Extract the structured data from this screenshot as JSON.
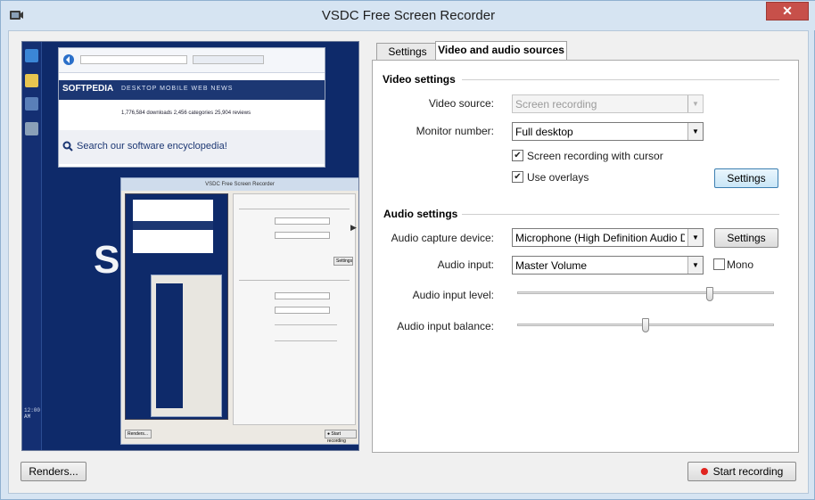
{
  "window": {
    "title": "VSDC Free Screen Recorder",
    "close_glyph": "✕",
    "icon": "recorder-app-icon"
  },
  "preview": {
    "browser_brand": "SOFTPEDIA",
    "browser_links": "DESKTOP  MOBILE  WEB  NEWS",
    "browser_row": "1,776,584 downloads   2,456 categories   25,904 reviews",
    "browser_search": "Search our software encyclopedia!",
    "big_letter": "S",
    "clock_text": "12:00 AM",
    "nested_title": "VSDC Free Screen Recorder",
    "nested_renders": "Renders...",
    "nested_start": "● Start recording",
    "nested_settings": "Settings"
  },
  "tabs": {
    "settings": "Settings",
    "video_audio": "Video and audio sources"
  },
  "video": {
    "heading": "Video settings",
    "source_label": "Video source:",
    "source_value": "Screen recording",
    "monitor_label": "Monitor number:",
    "monitor_value": "Full desktop",
    "cursor_label": "Screen recording with cursor",
    "cursor_checked": true,
    "overlays_label": "Use overlays",
    "overlays_checked": true,
    "settings_button": "Settings"
  },
  "audio": {
    "heading": "Audio settings",
    "device_label": "Audio capture device:",
    "device_value": "Microphone (High Definition Audio Device)",
    "device_settings_button": "Settings",
    "input_label": "Audio input:",
    "input_value": "Master Volume",
    "mono_label": "Mono",
    "mono_checked": false,
    "level_label": "Audio input level:",
    "level_value": 0.75,
    "balance_label": "Audio input balance:",
    "balance_value": 0.5
  },
  "footer": {
    "renders_button": "Renders...",
    "start_button": "Start recording"
  },
  "colors": {
    "title_bar": "#d6e4f2",
    "close_button": "#c7504a",
    "preview_bg": "#0e2a6a",
    "record_dot": "#e0241f"
  }
}
